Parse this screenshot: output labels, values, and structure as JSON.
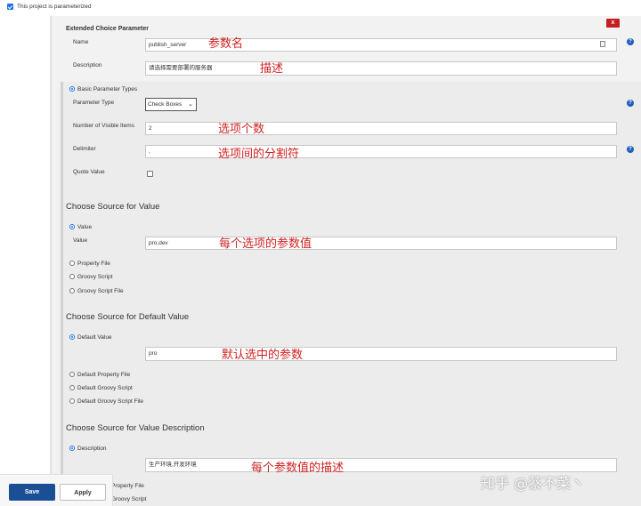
{
  "top": {
    "checkbox_label": "This project is parameterized"
  },
  "section_title": "Extended Choice Parameter",
  "close_label": "x",
  "fields": {
    "name_label": "Name",
    "name_value": "publish_server",
    "description_label": "Description",
    "description_value": "请选择需要部署的服务器",
    "basic_types_label": "Basic Parameter Types",
    "param_type_label": "Parameter Type",
    "param_type_value": "Check Boxes",
    "visible_items_label": "Number of Visible Items",
    "visible_items_value": "2",
    "delimiter_label": "Delimiter",
    "delimiter_value": ",",
    "quote_value_label": "Quote Value"
  },
  "source_value": {
    "heading": "Choose Source for Value",
    "value_radio": "Value",
    "value_label": "Value",
    "value_value": "pro,dev",
    "property_file": "Property File",
    "groovy_script": "Groovy Script",
    "groovy_script_file": "Groovy Script File"
  },
  "source_default": {
    "heading": "Choose Source for Default Value",
    "default_value_radio": "Default Value",
    "default_value_value": "pro",
    "default_property_file": "Default Property File",
    "default_groovy_script": "Default Groovy Script",
    "default_groovy_script_file": "Default Groovy Script File"
  },
  "source_description": {
    "heading": "Choose Source for Value Description",
    "description_radio": "Description",
    "description_value": "生产环境,开发环境",
    "property_file_partial": "Property File",
    "groovy_script_partial": "Groovy Script"
  },
  "buttons": {
    "save": "Save",
    "apply": "Apply"
  },
  "annotations": {
    "name": "参数名",
    "description": "描述",
    "visible_items": "选项个数",
    "delimiter": "选项间的分割符",
    "value": "每个选项的参数值",
    "default_value": "默认选中的参数",
    "value_description": "每个参数值的描述"
  },
  "watermark": "知乎 @蔡不菜丶",
  "help_icon_text": "?",
  "colors": {
    "primary_button": "#1a4f96",
    "close_button": "#c41e1e",
    "annotation": "#d12020",
    "accent": "#1a73e8"
  }
}
